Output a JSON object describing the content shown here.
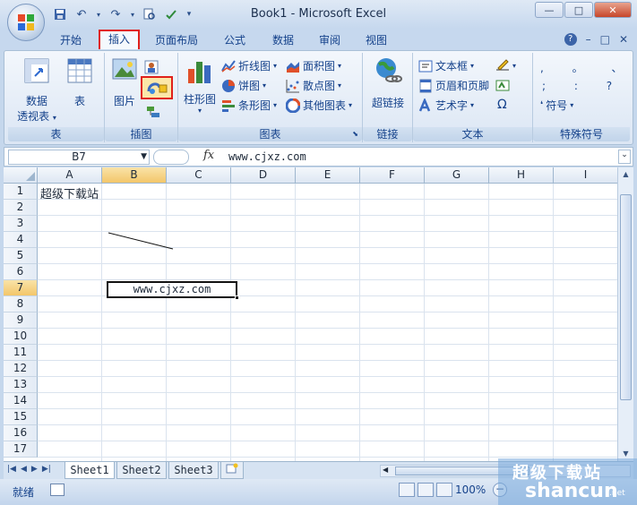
{
  "window": {
    "title": "Book1 - Microsoft Excel",
    "controls": [
      "—",
      "□",
      "✕"
    ]
  },
  "tabs": {
    "items": [
      "开始",
      "插入",
      "页面布局",
      "公式",
      "数据",
      "审阅",
      "视图"
    ],
    "active": "插入",
    "right_icons": [
      "?",
      "–",
      "□",
      "✕"
    ]
  },
  "ribbon": {
    "table_group": {
      "label": "表",
      "pivot_label_1": "数据",
      "pivot_label_2": "透视表",
      "table_label": "表"
    },
    "illustrations_group": {
      "label": "插图",
      "picture_label": "图片"
    },
    "charts_group": {
      "label": "图表",
      "column_label": "柱形图",
      "line_label": "折线图",
      "pie_label": "饼图",
      "bar_label": "条形图",
      "area_label": "面积图",
      "scatter_label": "散点图",
      "other_label": "其他图表"
    },
    "links_group": {
      "label": "链接",
      "hyperlink_label": "超链接"
    },
    "text_group": {
      "label": "文本",
      "textbox_label": "文本框",
      "headerfooter_label": "页眉和页脚",
      "wordart_label": "艺术字"
    },
    "symbols_group": {
      "label": "特殊符号",
      "symbol_label": "符号",
      "chars_row1": ", 。 、",
      "chars_row2": "; : ?",
      "omega": "Ω"
    }
  },
  "formula_bar": {
    "name_box": "B7",
    "fx": "fx",
    "content": "www.cjxz.com"
  },
  "grid": {
    "columns": [
      "A",
      "B",
      "C",
      "D",
      "E",
      "F",
      "G",
      "H",
      "I"
    ],
    "rows": [
      "1",
      "2",
      "3",
      "4",
      "5",
      "6",
      "7",
      "8",
      "9",
      "10",
      "11",
      "12",
      "13",
      "14",
      "15",
      "16",
      "17"
    ],
    "selected_column": "B",
    "selected_row": "7",
    "a1_text": "超级下载站",
    "b7_text": "www.cjxz.com"
  },
  "sheets": {
    "tabs": [
      "Sheet1",
      "Sheet2",
      "Sheet3"
    ],
    "active": "Sheet1"
  },
  "status": {
    "ready": "就绪",
    "zoom": "100%"
  },
  "watermark": {
    "top": "超级下载站",
    "bottom": "shancun",
    "suffix": ".net"
  },
  "colors": {
    "accent_red": "#e0201a",
    "selection_header": "#f3c66a",
    "ribbon_text": "#15428b"
  }
}
